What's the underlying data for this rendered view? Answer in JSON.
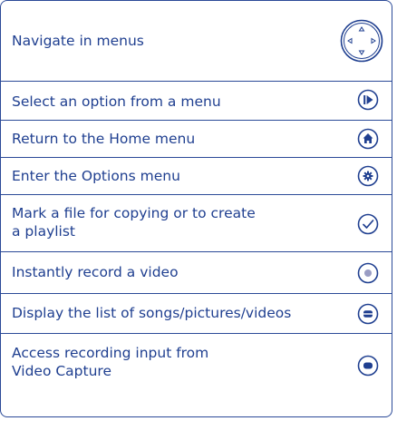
{
  "rows": [
    {
      "label": "Navigate in menus",
      "icon": "dpad-icon"
    },
    {
      "label": "Select an option from a menu",
      "icon": "play-pause-icon"
    },
    {
      "label": "Return to the Home menu",
      "icon": "home-icon"
    },
    {
      "label": "Enter the Options menu",
      "icon": "gear-icon"
    },
    {
      "label": "Mark a file for copying or to create\na playlist",
      "icon": "checkmark-icon"
    },
    {
      "label": "Instantly record a video",
      "icon": "record-icon"
    },
    {
      "label": "Display the list of songs/pictures/videos",
      "icon": "list-icon"
    },
    {
      "label": "Access recording input from\nVideo Capture",
      "icon": "minus-icon"
    }
  ],
  "colors": {
    "primary": "#1f3f90",
    "border": "#2b4a98"
  }
}
